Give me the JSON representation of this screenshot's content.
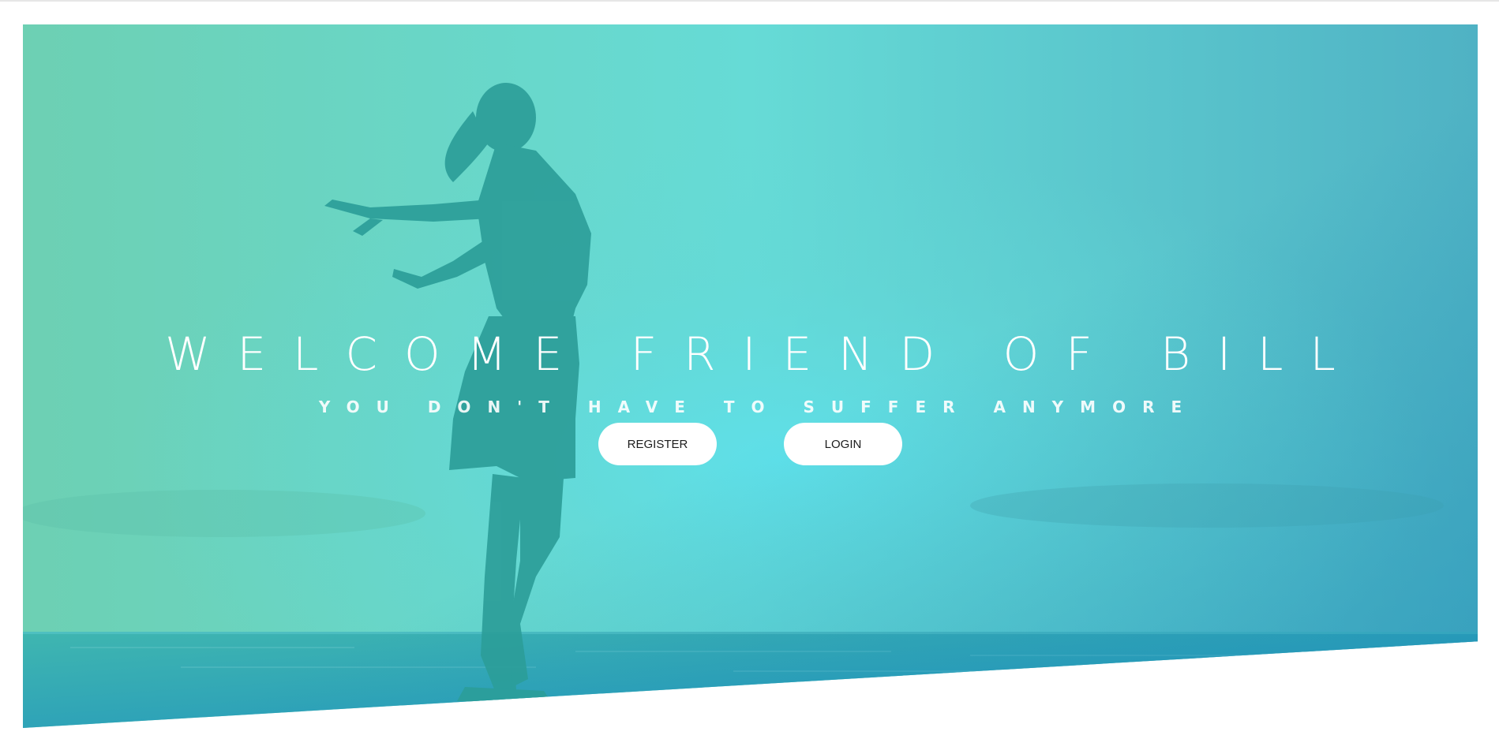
{
  "hero": {
    "title": "WELCOME FRIEND OF BILL",
    "subtitle": "YOU DON'T HAVE TO SUFFER ANYMORE",
    "buttons": {
      "register_label": "REGISTER",
      "login_label": "LOGIN"
    }
  },
  "colors": {
    "gradient_left": "#6fd0b6",
    "gradient_center": "#5fdbe0",
    "gradient_right": "#4aa8c2",
    "silhouette": "#2a9f98",
    "button_bg": "#ffffff",
    "text": "#ffffff"
  }
}
